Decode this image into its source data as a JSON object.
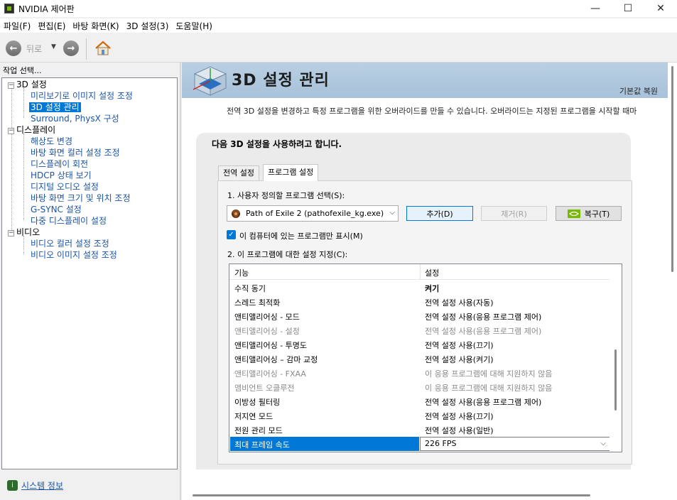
{
  "window": {
    "title": "NVIDIA 제어판",
    "minimize": "—",
    "maximize": "☐",
    "close": "✕"
  },
  "menu": [
    "파일(F)",
    "편집(E)",
    "바탕 화면(K)",
    "3D 설정(3)",
    "도움말(H)"
  ],
  "toolbar": {
    "back_label": "뒤로"
  },
  "task_select_label": "작업 선택...",
  "tree": {
    "categories": [
      {
        "label": "3D 설정",
        "children": [
          "미리보기로 이미지 설정 조정",
          "3D 설정 관리",
          "Surround, PhysX 구성"
        ]
      },
      {
        "label": "디스플레이",
        "children": [
          "해상도 변경",
          "바탕 화면 컬러 설정 조정",
          "디스플레이 회전",
          "HDCP 상태 보기",
          "디지털 오디오 설정",
          "바탕 화면 크기 및 위치 조정",
          "G-SYNC 설정",
          "다중 디스플레이 설정"
        ]
      },
      {
        "label": "비디오",
        "children": [
          "비디오 컬러 설정 조정",
          "비디오 이미지 설정 조정"
        ]
      }
    ],
    "selected": "3D 설정 관리"
  },
  "system_info_link": "시스템 정보",
  "page": {
    "title": "3D 설정 관리",
    "restore_default": "기본값 복원",
    "description": "전역 3D 설정을 변경하고 특정 프로그램을 위한 오버라이드를 만들 수 있습니다. 오버라이드는 지정된 프로그램을 시작할 때마",
    "settings_heading": "다음 3D 설정을 사용하려고 합니다.",
    "tabs": [
      "전역 설정",
      "프로그램 설정"
    ],
    "active_tab": "프로그램 설정",
    "step1_label": "1. 사용자 정의할 프로그램 선택(S):",
    "program_selected": "Path of Exile 2 (pathofexile_kg.exe)",
    "add_button": "추가(D)",
    "remove_button": "제거(R)",
    "restore_button": "복구(T)",
    "checkbox_label": "이 컴퓨터에 있는 프로그램만 표시(M)",
    "checkbox_checked": true,
    "step2_label": "2. 이 프로그램에 대한 설정 지정(C):",
    "grid": {
      "headers": [
        "기능",
        "설정"
      ],
      "rows": [
        {
          "feature": "수직 동기",
          "value": "켜기",
          "state": "bold"
        },
        {
          "feature": "스레드 최적화",
          "value": "전역 설정 사용(자동)",
          "state": "normal"
        },
        {
          "feature": "앤티앨리어싱 - 모드",
          "value": "전역 설정 사용(응용 프로그램 제어)",
          "state": "normal"
        },
        {
          "feature": "앤티앨리어싱 - 설정",
          "value": "전역 설정 사용(응용 프로그램 제어)",
          "state": "disabled"
        },
        {
          "feature": "앤티앨리어싱 - 투명도",
          "value": "전역 설정 사용(끄기)",
          "state": "normal"
        },
        {
          "feature": "앤티앨리어싱 – 감마 교정",
          "value": "전역 설정 사용(켜기)",
          "state": "normal"
        },
        {
          "feature": "앤티앨리어싱 - FXAA",
          "value": "이 응용 프로그램에 대해 지원하지 않음",
          "state": "disabled"
        },
        {
          "feature": "앰비언트 오클루전",
          "value": "이 응용 프로그램에 대해 지원하지 않음",
          "state": "disabled"
        },
        {
          "feature": "이방성 필터링",
          "value": "전역 설정 사용(응용 프로그램 제어)",
          "state": "normal"
        },
        {
          "feature": "저지연 모드",
          "value": "전역 설정 사용(끄기)",
          "state": "normal"
        },
        {
          "feature": "전원 관리 모드",
          "value": "전역 설정 사용(일반)",
          "state": "normal"
        },
        {
          "feature": "최대 프레임 속도",
          "value": "226 FPS",
          "state": "selected"
        }
      ]
    }
  }
}
